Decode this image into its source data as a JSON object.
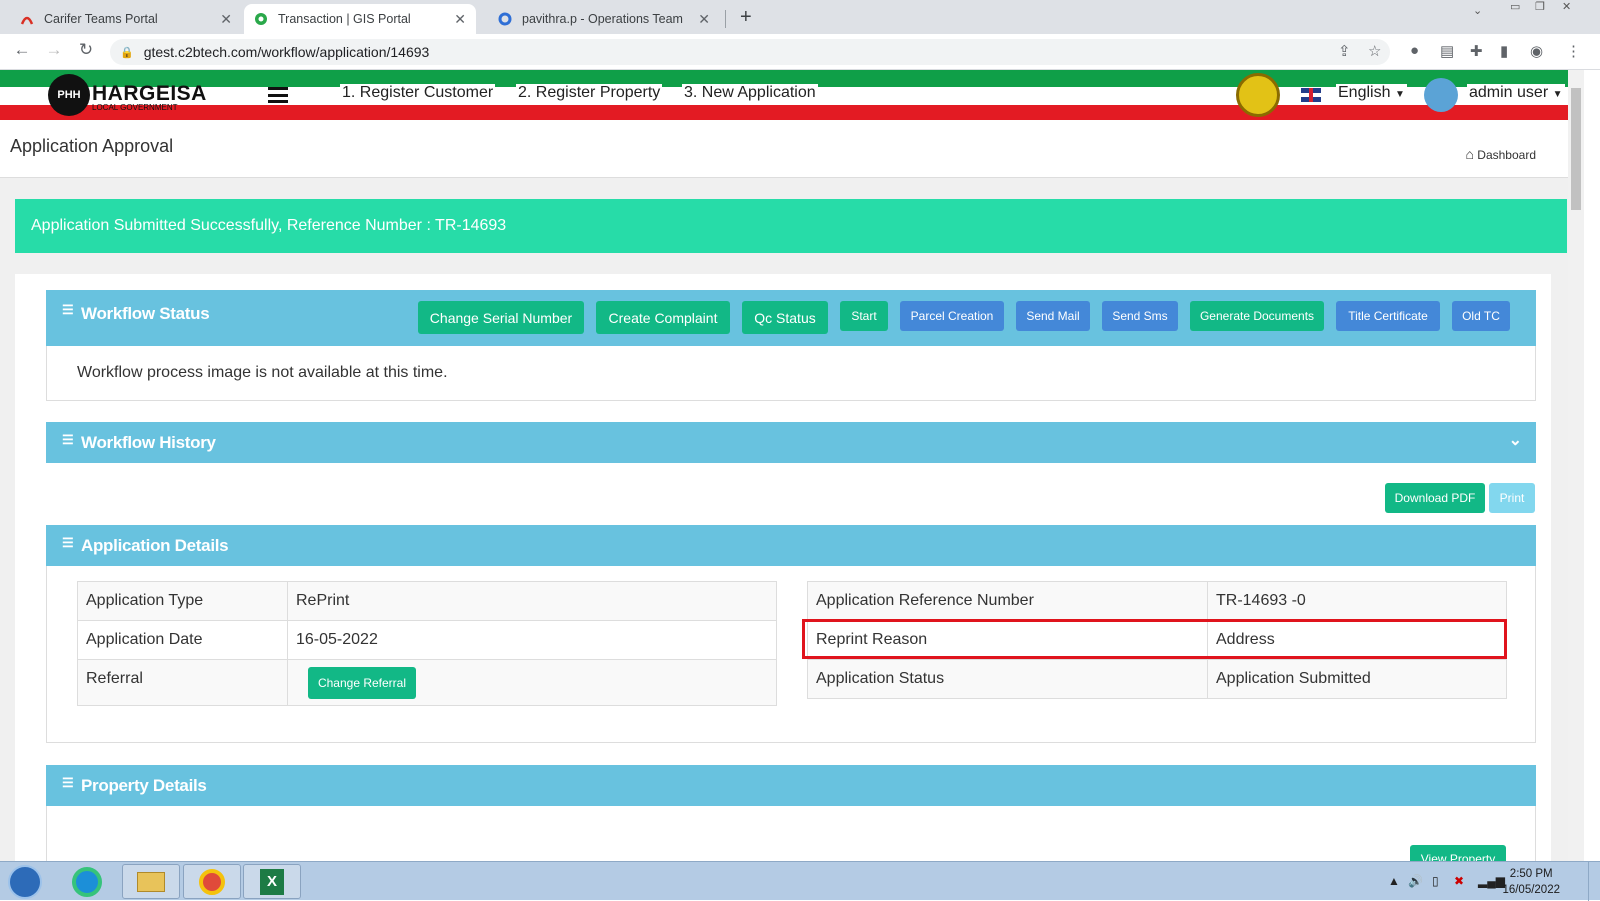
{
  "browser": {
    "tabs": [
      {
        "title": "Carifer Teams Portal"
      },
      {
        "title": "Transaction | GIS Portal"
      },
      {
        "title": "pavithra.p - Operations Team Co"
      }
    ],
    "url": "gtest.c2btech.com/workflow/application/14693"
  },
  "header": {
    "logo_text": "HARGEISA",
    "logo_sub": "LOCAL GOVERNMENT",
    "logo_badge": "PHH",
    "menu": [
      "1. Register Customer",
      "2. Register Property",
      "3. New Application"
    ],
    "language": "English",
    "user": "admin user"
  },
  "page": {
    "title": "Application Approval",
    "breadcrumb": "Dashboard"
  },
  "alert": {
    "text": "Application Submitted Successfully, Reference Number : TR-14693"
  },
  "workflow_status": {
    "title": "Workflow Status",
    "buttons": [
      "Change Serial Number",
      "Create Complaint",
      "Qc Status",
      "Start",
      "Parcel Creation",
      "Send Mail",
      "Send Sms",
      "Generate Documents",
      "Title Certificate",
      "Old TC"
    ],
    "message": "Workflow process image is not available at this time."
  },
  "workflow_history": {
    "title": "Workflow History"
  },
  "actions": {
    "download_pdf": "Download PDF",
    "print": "Print"
  },
  "application_details": {
    "title": "Application Details",
    "left": [
      {
        "label": "Application Type",
        "value": "RePrint"
      },
      {
        "label": "Application Date",
        "value": "16-05-2022"
      },
      {
        "label": "Referral",
        "button": "Change Referral"
      }
    ],
    "right": [
      {
        "label": "Application Reference Number",
        "value": "TR-14693 -0"
      },
      {
        "label": "Reprint Reason",
        "value": "Address"
      },
      {
        "label": "Application Status",
        "value": "Application Submitted"
      }
    ]
  },
  "property_details": {
    "title": "Property Details",
    "view_button": "View Property"
  },
  "taskbar": {
    "time": "2:50 PM",
    "date": "16/05/2022"
  },
  "colors": {
    "panel_header": "#68c2df",
    "alert": "#27dca8",
    "btn_green": "#12b886",
    "btn_blue": "#4488d8",
    "highlight": "#e0141d"
  }
}
